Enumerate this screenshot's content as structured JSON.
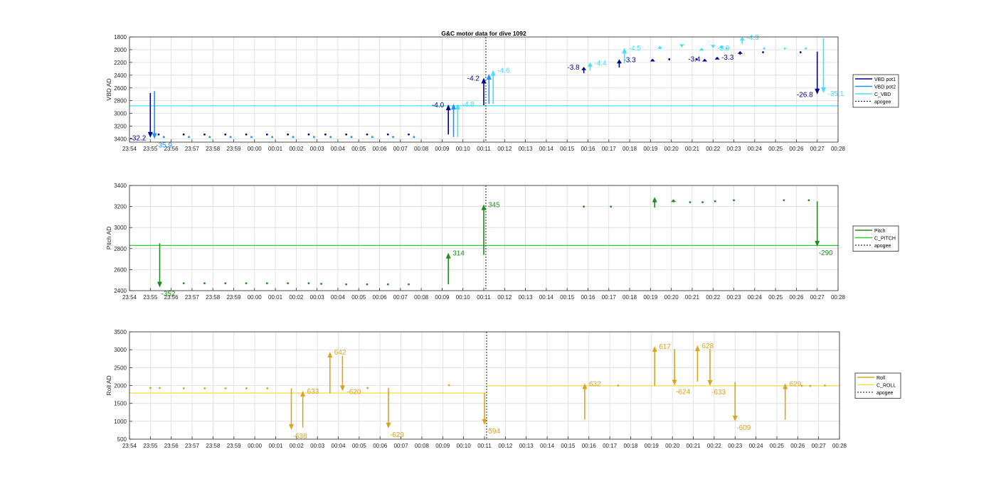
{
  "figure": {
    "title": "G&C motor data for dive 1092"
  },
  "chart_data": [
    {
      "type": "line",
      "ylabel": "VBD AD",
      "ylim": [
        1800,
        3450
      ],
      "y_reversed": true,
      "y_ticks": [
        1800,
        2000,
        2200,
        2400,
        2600,
        2800,
        3000,
        3200,
        3400
      ],
      "grid": true,
      "legend_position": "right",
      "x_tick_labels": [
        "23:54",
        "23:55",
        "23:56",
        "23:57",
        "23:58",
        "23:59",
        "00:00",
        "00:01",
        "00:02",
        "00:03",
        "00:04",
        "00:05",
        "00:06",
        "00:07",
        "00:08",
        "00:09",
        "00:10",
        "00:11",
        "00:12",
        "00:13",
        "00:14",
        "00:15",
        "00:16",
        "00:17",
        "00:18",
        "00:19",
        "00:20",
        "00:21",
        "00:22",
        "00:23",
        "00:24",
        "00:25",
        "00:26",
        "00:27",
        "00:28"
      ],
      "apogee": 17.1,
      "legend": [
        {
          "label": "VBD pot1",
          "color": "#00008B",
          "dashed": false
        },
        {
          "label": "VBD pot2",
          "color": "#1E90FF",
          "dashed": false
        },
        {
          "label": "C_VBD",
          "color": "#40E0FF",
          "dashed": false
        },
        {
          "label": "apogee",
          "color": "#000000",
          "dashed": true
        }
      ],
      "reference_lines": [
        {
          "name": "C_VBD",
          "color": "#40E0FF",
          "segments": [
            [
              0,
              2880,
              34,
              2880
            ]
          ]
        }
      ],
      "series": [
        {
          "name": "VBD pot1",
          "color": "#00008B",
          "points": [
            [
              1.4,
              3330
            ],
            [
              2.6,
              3330
            ],
            [
              3.6,
              3330
            ],
            [
              4.6,
              3330
            ],
            [
              5.6,
              3330
            ],
            [
              6.6,
              3330
            ],
            [
              7.6,
              3330
            ],
            [
              8.6,
              3330
            ],
            [
              9.4,
              3330
            ],
            [
              10.4,
              3330
            ],
            [
              11.4,
              3330
            ],
            [
              12.4,
              3330
            ],
            [
              13.4,
              3330
            ],
            [
              25.9,
              2150
            ],
            [
              27.2,
              2150
            ],
            [
              30.4,
              2040
            ],
            [
              32.2,
              2040
            ]
          ],
          "arrows": [
            {
              "x": 1.0,
              "y0": 2680,
              "y1": 3380,
              "label": "-32.2",
              "label_pos": "left"
            },
            {
              "x": 15.3,
              "y0": 3330,
              "y1": 2860,
              "label": "-4.0",
              "label_pos": "left"
            },
            {
              "x": 17.0,
              "y0": 2870,
              "y1": 2440,
              "label": "-4.2",
              "label_pos": "left"
            },
            {
              "x": 21.8,
              "y0": 2370,
              "y1": 2270,
              "label": "-3.8",
              "label_pos": "left"
            },
            {
              "x": 23.5,
              "y0": 2280,
              "y1": 2150,
              "label": "-3.3",
              "label_pos": "right"
            },
            {
              "x": 25.1,
              "y0": 2170,
              "y1": 2140,
              "label": "",
              "label_pos": "right"
            },
            {
              "x": 27.6,
              "y0": 2150,
              "y1": 2140,
              "label": "-3.4",
              "label_pos": "left"
            },
            {
              "x": 28.2,
              "y0": 2150,
              "y1": 2110,
              "label": "-3.3",
              "label_pos": "right"
            },
            {
              "x": 29.3,
              "y0": 2080,
              "y1": 2020,
              "label": "",
              "label_pos": "right"
            },
            {
              "x": 33.0,
              "y0": 2030,
              "y1": 2700,
              "label": "-26.8",
              "label_pos": "left"
            }
          ]
        },
        {
          "name": "VBD pot2",
          "color": "#1E90FF",
          "points": [
            [
              1.65,
              3370
            ],
            [
              2.85,
              3370
            ],
            [
              3.85,
              3370
            ],
            [
              4.85,
              3370
            ],
            [
              5.85,
              3370
            ],
            [
              6.85,
              3370
            ],
            [
              7.85,
              3370
            ],
            [
              8.85,
              3370
            ],
            [
              9.65,
              3370
            ],
            [
              10.65,
              3370
            ],
            [
              11.65,
              3370
            ],
            [
              12.65,
              3370
            ],
            [
              13.65,
              3370
            ]
          ],
          "arrows": [
            {
              "x": 1.2,
              "y0": 2650,
              "y1": 3400,
              "label": "-35.9",
              "label_pos": "below"
            },
            {
              "x": 15.55,
              "y0": 3370,
              "y1": 2850,
              "label": "",
              "label_pos": "right"
            },
            {
              "x": 17.25,
              "y0": 2850,
              "y1": 2380,
              "label": "",
              "label_pos": "right"
            }
          ]
        },
        {
          "name": "C_VBD",
          "color": "#40E0FF",
          "points": [
            [
              28.65,
              1980
            ],
            [
              30.45,
              1980
            ],
            [
              31.45,
              1980
            ],
            [
              32.45,
              1980
            ]
          ],
          "arrows": [
            {
              "x": 15.75,
              "y0": 3370,
              "y1": 2850,
              "label": "-4.8",
              "label_pos": "right"
            },
            {
              "x": 17.45,
              "y0": 2850,
              "y1": 2320,
              "label": "-4.6",
              "label_pos": "right"
            },
            {
              "x": 22.1,
              "y0": 2330,
              "y1": 2200,
              "label": "-4.4",
              "label_pos": "right"
            },
            {
              "x": 23.75,
              "y0": 2210,
              "y1": 1970,
              "label": "-4.5",
              "label_pos": "right"
            },
            {
              "x": 25.45,
              "y0": 1990,
              "y1": 1940,
              "label": "",
              "label_pos": "right"
            },
            {
              "x": 26.5,
              "y0": 1960,
              "y1": 1960,
              "label": "",
              "label_pos": "right"
            },
            {
              "x": 27.45,
              "y0": 1980,
              "y1": 1970,
              "label": "",
              "label_pos": "right"
            },
            {
              "x": 28.0,
              "y0": 1970,
              "y1": 1970,
              "label": "-3.9",
              "label_pos": "right"
            },
            {
              "x": 28.4,
              "y0": 1990,
              "y1": 1930,
              "label": "",
              "label_pos": "right"
            },
            {
              "x": 29.4,
              "y0": 1910,
              "y1": 1800,
              "label": "-4.3",
              "label_pos": "right"
            },
            {
              "x": 33.3,
              "y0": 1820,
              "y1": 2680,
              "label": "-35.1",
              "label_pos": "right"
            }
          ]
        }
      ]
    },
    {
      "type": "line",
      "ylabel": "Pitch AD",
      "ylim": [
        2400,
        3400
      ],
      "y_reversed": false,
      "y_ticks": [
        2400,
        2600,
        2800,
        3000,
        3200,
        3400
      ],
      "grid": true,
      "legend_position": "right",
      "x_tick_labels": [
        "23:54",
        "23:55",
        "23:56",
        "23:57",
        "23:58",
        "23:59",
        "00:00",
        "00:01",
        "00:02",
        "00:03",
        "00:04",
        "00:05",
        "00:06",
        "00:07",
        "00:08",
        "00:09",
        "00:10",
        "00:11",
        "00:12",
        "00:13",
        "00:14",
        "00:15",
        "00:16",
        "00:17",
        "00:18",
        "00:19",
        "00:20",
        "00:21",
        "00:22",
        "00:23",
        "00:24",
        "00:25",
        "00:26",
        "00:27",
        "00:28"
      ],
      "apogee": 17.1,
      "legend": [
        {
          "label": "Pitch",
          "color": "#228B22",
          "dashed": false
        },
        {
          "label": "C_PITCH",
          "color": "#32CD32",
          "dashed": false
        },
        {
          "label": "apogee",
          "color": "#000000",
          "dashed": true
        }
      ],
      "reference_lines": [
        {
          "name": "C_PITCH",
          "color": "#32CD32",
          "segments": [
            [
              0,
              2830,
              34,
              2830
            ]
          ]
        }
      ],
      "series": [
        {
          "name": "Pitch",
          "color": "#228B22",
          "points": [
            [
              2.6,
              2470
            ],
            [
              3.6,
              2470
            ],
            [
              4.6,
              2470
            ],
            [
              5.6,
              2470
            ],
            [
              6.6,
              2470
            ],
            [
              7.6,
              2470
            ],
            [
              8.6,
              2470
            ],
            [
              9.2,
              2465
            ],
            [
              10.4,
              2460
            ],
            [
              11.4,
              2460
            ],
            [
              12.4,
              2460
            ],
            [
              13.4,
              2460
            ],
            [
              21.8,
              3200
            ],
            [
              23.1,
              3200
            ],
            [
              26.9,
              3240
            ],
            [
              27.5,
              3240
            ],
            [
              28.1,
              3250
            ],
            [
              29.0,
              3260
            ],
            [
              31.4,
              3260
            ],
            [
              32.6,
              3260
            ]
          ],
          "arrows": [
            {
              "x": 1.45,
              "y0": 2850,
              "y1": 2430,
              "label": "-352",
              "label_pos": "below"
            },
            {
              "x": 15.3,
              "y0": 2460,
              "y1": 2760,
              "label": "314",
              "label_pos": "right"
            },
            {
              "x": 17.0,
              "y0": 2740,
              "y1": 3220,
              "label": "345",
              "label_pos": "right"
            },
            {
              "x": 25.2,
              "y0": 3190,
              "y1": 3290,
              "label": "",
              "label_pos": "right"
            },
            {
              "x": 26.1,
              "y0": 3240,
              "y1": 3270,
              "label": "",
              "label_pos": "right"
            },
            {
              "x": 33.0,
              "y0": 3250,
              "y1": 2820,
              "label": "-290",
              "label_pos": "below"
            }
          ]
        }
      ]
    },
    {
      "type": "line",
      "ylabel": "Roll AD",
      "ylim": [
        500,
        3500
      ],
      "y_reversed": false,
      "y_ticks": [
        500,
        1000,
        1500,
        2000,
        2500,
        3000,
        3500
      ],
      "grid": true,
      "legend_position": "right",
      "x_tick_labels": [
        "23:54",
        "23:55",
        "23:56",
        "23:57",
        "23:58",
        "23:59",
        "00:00",
        "00:01",
        "00:02",
        "00:03",
        "00:04",
        "00:05",
        "00:06",
        "00:07",
        "00:08",
        "00:09",
        "00:10",
        "00:11",
        "00:12",
        "00:13",
        "00:14",
        "00:15",
        "00:16",
        "00:17",
        "00:18",
        "00:19",
        "00:20",
        "00:21",
        "00:22",
        "00:23",
        "00:24",
        "00:25",
        "00:26",
        "00:27",
        "00:28"
      ],
      "apogee": 17.1,
      "legend": [
        {
          "label": "Roll",
          "color": "#DAA520",
          "dashed": false
        },
        {
          "label": "C_ROLL",
          "color": "#F5E050",
          "dashed": false
        },
        {
          "label": "apogee",
          "color": "#000000",
          "dashed": true
        }
      ],
      "reference_lines": [
        {
          "name": "C_ROLL",
          "color": "#F5E050",
          "segments": [
            [
              0,
              1790,
              17.1,
              1790
            ],
            [
              17.1,
              1990,
              34,
              1990
            ]
          ]
        }
      ],
      "series": [
        {
          "name": "Roll",
          "color": "#DAA520",
          "points": [
            [
              1.0,
              1930
            ],
            [
              1.45,
              1930
            ],
            [
              2.6,
              1920
            ],
            [
              3.6,
              1920
            ],
            [
              4.6,
              1920
            ],
            [
              5.6,
              1920
            ],
            [
              6.6,
              1920
            ],
            [
              11.4,
              1930
            ],
            [
              15.3,
              2010
            ],
            [
              23.4,
              2000
            ],
            [
              32.2,
              1990
            ],
            [
              32.6,
              1990
            ],
            [
              33.3,
              2000
            ]
          ],
          "arrows": [
            {
              "x": 7.75,
              "y0": 1920,
              "y1": 760,
              "label": "-638",
              "label_pos": "below"
            },
            {
              "x": 8.3,
              "y0": 830,
              "y1": 1850,
              "label": "633",
              "label_pos": "right"
            },
            {
              "x": 9.6,
              "y0": 1780,
              "y1": 2940,
              "label": "642",
              "label_pos": "right"
            },
            {
              "x": 10.2,
              "y0": 2830,
              "y1": 1840,
              "label": "-620",
              "label_pos": "right"
            },
            {
              "x": 12.4,
              "y0": 1930,
              "y1": 800,
              "label": "-629",
              "label_pos": "below"
            },
            {
              "x": 17.0,
              "y0": 1790,
              "y1": 900,
              "label": "-594",
              "label_pos": "below"
            },
            {
              "x": 21.8,
              "y0": 1050,
              "y1": 2060,
              "label": "632",
              "label_pos": "right"
            },
            {
              "x": 25.15,
              "y0": 1990,
              "y1": 3100,
              "label": "617",
              "label_pos": "right"
            },
            {
              "x": 26.1,
              "y0": 3020,
              "y1": 2000,
              "label": "-624",
              "label_pos": "below"
            },
            {
              "x": 27.2,
              "y0": 2110,
              "y1": 3120,
              "label": "628",
              "label_pos": "right"
            },
            {
              "x": 27.8,
              "y0": 3020,
              "y1": 1990,
              "label": "-633",
              "label_pos": "below"
            },
            {
              "x": 29.0,
              "y0": 2100,
              "y1": 1000,
              "label": "-609",
              "label_pos": "below"
            },
            {
              "x": 31.4,
              "y0": 1040,
              "y1": 2060,
              "label": "629",
              "label_pos": "right"
            }
          ]
        }
      ]
    }
  ]
}
